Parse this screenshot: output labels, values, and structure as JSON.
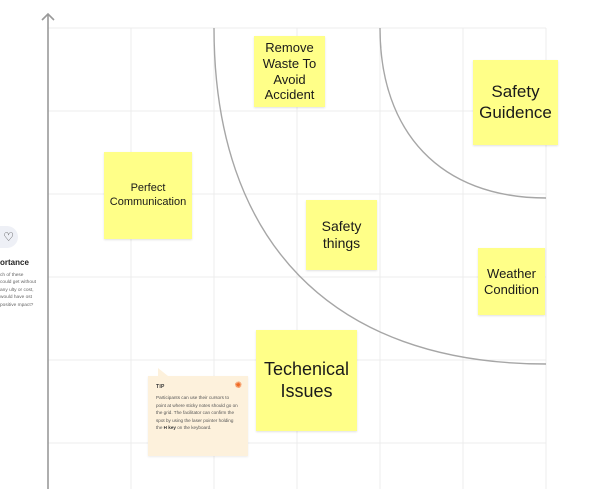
{
  "stickies": [
    {
      "id": "remove-waste",
      "text": "Remove Waste To Avoid Accident"
    },
    {
      "id": "safety-guidence",
      "text": "Safety Guidence"
    },
    {
      "id": "perfect-communication",
      "text": "Perfect Communication"
    },
    {
      "id": "safety-things",
      "text": "Safety things"
    },
    {
      "id": "weather-condition",
      "text": "Weather Condition"
    },
    {
      "id": "techenical-issues",
      "text": "Techenical Issues"
    }
  ],
  "tip": {
    "title": "TIP",
    "body_start": "Participants can use their cursors to point at where sticky notes should go on the grid. The facilitator can confirm the spot by using the laser pointer holding the ",
    "key": "H key",
    "body_end": " on the keyboard.",
    "icon": "lightbulb-icon"
  },
  "side_panel": {
    "icon": "heart-icon",
    "label": "ortance",
    "description": "ch of these could get without any ulty or cost, would have ost positive mpact?"
  },
  "colors": {
    "sticky": "#ffff88",
    "tip_background": "#fdf1dc",
    "tip_icon": "#f06a24",
    "grid": "#ececec",
    "axis": "#999999",
    "curve": "#a6a6a6"
  }
}
